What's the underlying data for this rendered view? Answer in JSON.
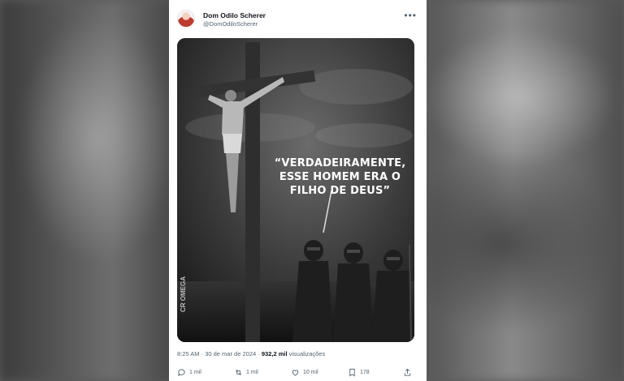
{
  "post": {
    "author_name": "Dom Odilo Scherer",
    "author_handle": "@DomOdiloScherer",
    "image_quote": "“VERDADEIRAMENTE, ESSE HOMEM ERA O FILHO DE DEUS”",
    "image_watermark": "CR OMEGA",
    "time": "8:25 AM",
    "date": "30 de mar de 2024",
    "views_count": "932,2 mil",
    "views_label": "visualizações",
    "replies": "1 mil",
    "reposts": "1 mil",
    "likes": "10 mil",
    "bookmarks": "178"
  },
  "icons": {
    "more": "more-icon",
    "reply": "reply-icon",
    "repost": "repost-icon",
    "like": "heart-icon",
    "bookmark": "bookmark-icon",
    "share": "share-icon"
  }
}
